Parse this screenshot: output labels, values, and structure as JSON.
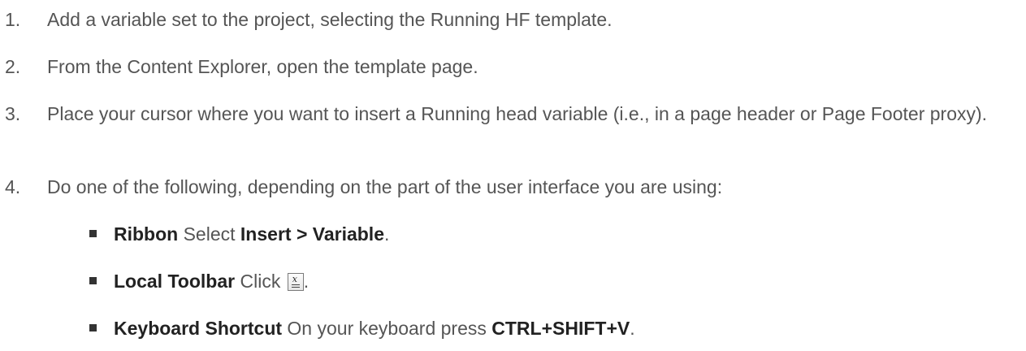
{
  "steps": [
    {
      "num": "1.",
      "text": "Add a variable set to the project, selecting the Running HF template."
    },
    {
      "num": "2.",
      "text": "From the Content Explorer, open the template page."
    },
    {
      "num": "3.",
      "text": "Place your cursor where you want to insert a Running head variable (i.e., in a page header or Page Footer proxy)."
    },
    {
      "num": "4.",
      "text": "Do one of the following, depending on the part of the user interface you are using:"
    }
  ],
  "options": [
    {
      "label": "Ribbon",
      "pre": " Select ",
      "ui": "Insert > Variable",
      "post": "."
    },
    {
      "label": "Local Toolbar",
      "pre": " Click ",
      "icon": "insert-variable-icon",
      "post": "."
    },
    {
      "label": "Keyboard Shortcut",
      "pre": " On your keyboard press ",
      "ui": "CTRL+SHIFT+V",
      "post": "."
    }
  ]
}
